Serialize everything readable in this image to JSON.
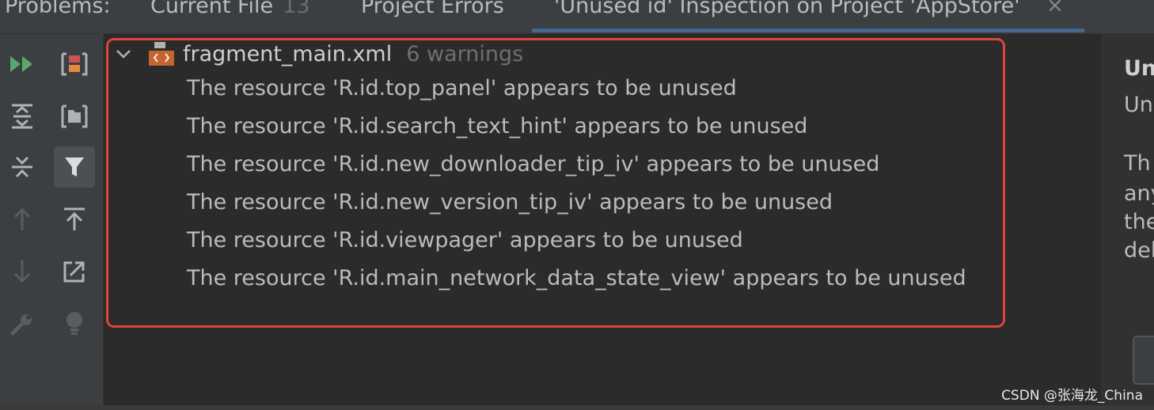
{
  "tabs": [
    {
      "label": "Problems:",
      "count": ""
    },
    {
      "label": "Current File",
      "count": "13"
    },
    {
      "label": "Project Errors",
      "count": ""
    },
    {
      "label": "'Unused id' Inspection on Project 'AppStore'",
      "count": ""
    }
  ],
  "tab_close_glyph": "×",
  "toolbar": {
    "col1": [
      "run-icon",
      "expand-all-icon",
      "collapse-all-icon",
      "previous-icon",
      "next-icon",
      "settings-icon"
    ],
    "col2": [
      "group-by-severity-icon",
      "group-by-directory-icon",
      "filter-icon",
      "export-icon",
      "open-external-icon",
      "quick-fix-icon"
    ],
    "colors": {
      "run": "#59a869",
      "disabled": "#5a5d5f",
      "icon": "#afb1b3",
      "accent_orange": "#e08a3c",
      "accent_red": "#c75450"
    }
  },
  "file_node": {
    "name": "fragment_main.xml",
    "count": "6 warnings",
    "icon": "xml-file-icon"
  },
  "warnings": [
    "The resource 'R.id.top_panel' appears to be unused",
    "The resource 'R.id.search_text_hint' appears to be unused",
    "The resource 'R.id.new_downloader_tip_iv' appears to be unused",
    "The resource 'R.id.new_version_tip_iv' appears to be unused",
    "The resource 'R.id.viewpager' appears to be unused",
    "The resource 'R.id.main_network_data_state_view' appears to be unused"
  ],
  "right_panel": {
    "title": "Un",
    "lines": [
      "Un",
      "Th",
      "any",
      "the",
      "del"
    ]
  },
  "highlight_color": "#e0443a",
  "watermark": "CSDN @张海龙_China"
}
